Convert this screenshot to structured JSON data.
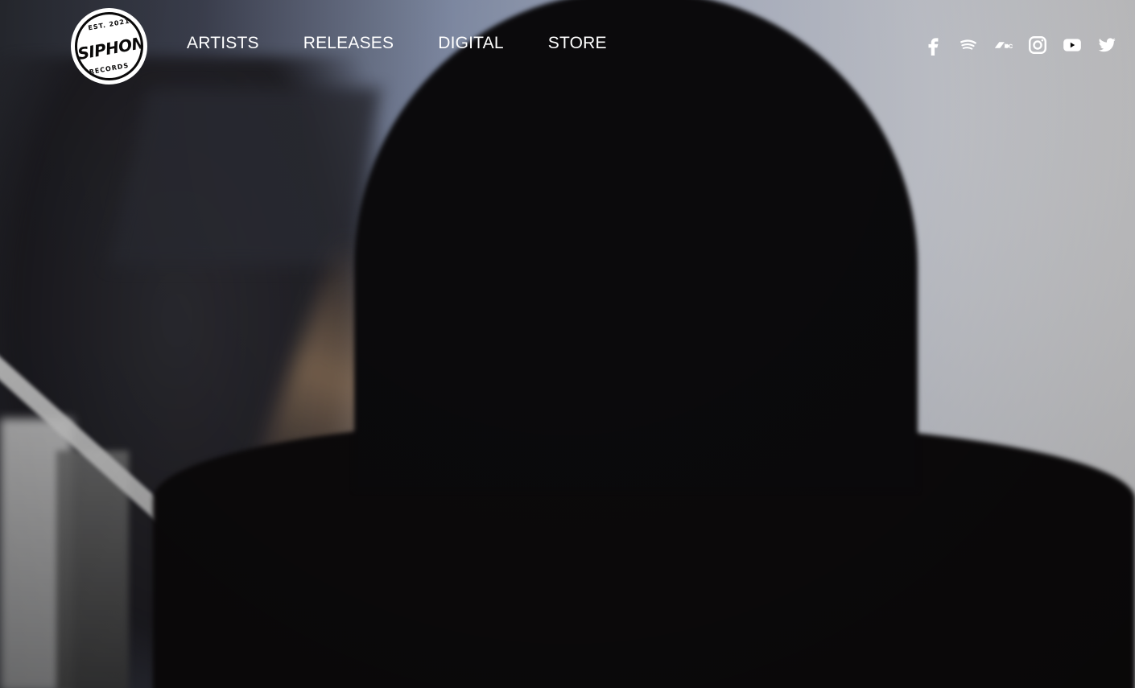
{
  "brand": {
    "logo_top_text": "EST. 2021",
    "logo_main_text": "SIPHON",
    "logo_bottom_text": "RECORDS"
  },
  "nav": {
    "items": [
      {
        "label": "ARTISTS"
      },
      {
        "label": "RELEASES"
      },
      {
        "label": "DIGITAL"
      },
      {
        "label": "STORE"
      }
    ]
  },
  "social": {
    "icons": [
      "facebook-icon",
      "spotify-icon",
      "bandcamp-icon",
      "instagram-icon",
      "youtube-icon",
      "twitter-icon"
    ]
  },
  "theme": {
    "text_color": "#ffffff",
    "background_dark": "#0a0909"
  }
}
